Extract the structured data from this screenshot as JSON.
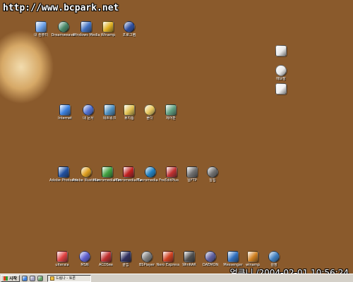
{
  "watermark": "http://www.bcpark.net",
  "overlay_datetime": "얼큰니 /2004-02-01 10:56:24",
  "desktop_icons": {
    "row1": [
      {
        "label": "내 컴퓨터",
        "icon": "my-computer-icon",
        "color": "#6aa0e8"
      },
      {
        "label": "Dreamweaver",
        "icon": "dreamweaver-icon",
        "color": "#4a8a6a"
      },
      {
        "label": "Windows Media",
        "icon": "media-player-icon",
        "color": "#4070c0"
      },
      {
        "label": "Winamp",
        "icon": "winamp-icon",
        "color": "#e0b020"
      },
      {
        "label": "프로그램",
        "icon": "program-icon",
        "color": "#3050a0"
      }
    ],
    "row2": [
      {
        "label": "Internet",
        "icon": "internet-icon",
        "color": "#3a80e0"
      },
      {
        "label": "내 문서",
        "icon": "documents-icon",
        "color": "#5070d0"
      },
      {
        "label": "네트워크",
        "icon": "network-icon",
        "color": "#5090c0"
      },
      {
        "label": "휴지통",
        "icon": "recycle-bin-icon",
        "color": "#e0c050"
      },
      {
        "label": "폴더",
        "icon": "folder-icon",
        "color": "#e8c860"
      },
      {
        "label": "제어판",
        "icon": "control-panel-icon",
        "color": "#60a080"
      }
    ],
    "row3": [
      {
        "label": "Adobe Photoshop",
        "icon": "photoshop-icon",
        "color": "#2050a0"
      },
      {
        "label": "Adobe Illustrator",
        "icon": "illustrator-icon",
        "color": "#e0a020"
      },
      {
        "label": "Macromedia Fireworks",
        "icon": "fireworks-icon",
        "color": "#40a040"
      },
      {
        "label": "Macromedia Flash MX",
        "icon": "flash-icon",
        "color": "#c02020"
      },
      {
        "label": "Macromedia Freehand",
        "icon": "freehand-icon",
        "color": "#2080c0"
      },
      {
        "label": "EditPlus",
        "icon": "editplus-icon",
        "color": "#c03030"
      },
      {
        "label": "알FTP",
        "icon": "ftp-icon",
        "color": "#707070"
      },
      {
        "label": "알집",
        "icon": "alzip-icon",
        "color": "#707070"
      }
    ],
    "right_column": [
      {
        "label": "",
        "icon": "disk-icon",
        "color": "#e8e8e8"
      },
      {
        "label": "메모장",
        "icon": "notepad-icon",
        "color": "#e8e8e8"
      },
      {
        "label": "",
        "icon": "text-file-icon",
        "color": "#f0f0f0"
      }
    ],
    "bottom_row": [
      {
        "label": "uiterala",
        "icon": "app-icon-1",
        "color": "#e04040"
      },
      {
        "label": "MSN",
        "icon": "msn-icon",
        "color": "#6060d0"
      },
      {
        "label": "ACDSee",
        "icon": "acdsee-icon",
        "color": "#c03030"
      },
      {
        "label": "클립",
        "icon": "clip-icon",
        "color": "#303060"
      },
      {
        "label": "BSPlayer",
        "icon": "bsplayer-icon",
        "color": "#808080"
      },
      {
        "label": "Nero Express",
        "icon": "nero-icon",
        "color": "#d04020"
      },
      {
        "label": "WinRAR",
        "icon": "winrar-icon",
        "color": "#505050"
      },
      {
        "label": "DAEMON",
        "icon": "daemon-icon",
        "color": "#6060a0"
      },
      {
        "label": "Messenger",
        "icon": "messenger-icon",
        "color": "#3070c0"
      },
      {
        "label": "winamp",
        "icon": "winamp2-icon",
        "color": "#d08020"
      },
      {
        "label": "설정",
        "icon": "settings-icon",
        "color": "#4080c0"
      }
    ]
  },
  "taskbar": {
    "start_label": "시작",
    "quick_launch": [
      {
        "icon": "ie-quicklaunch-icon",
        "color": "#3a80e0"
      },
      {
        "icon": "desktop-quicklaunch-icon",
        "color": "#a0a0c0"
      },
      {
        "icon": "media-quicklaunch-icon",
        "color": "#60a060"
      }
    ],
    "active_task": "드림나 - 토론"
  }
}
